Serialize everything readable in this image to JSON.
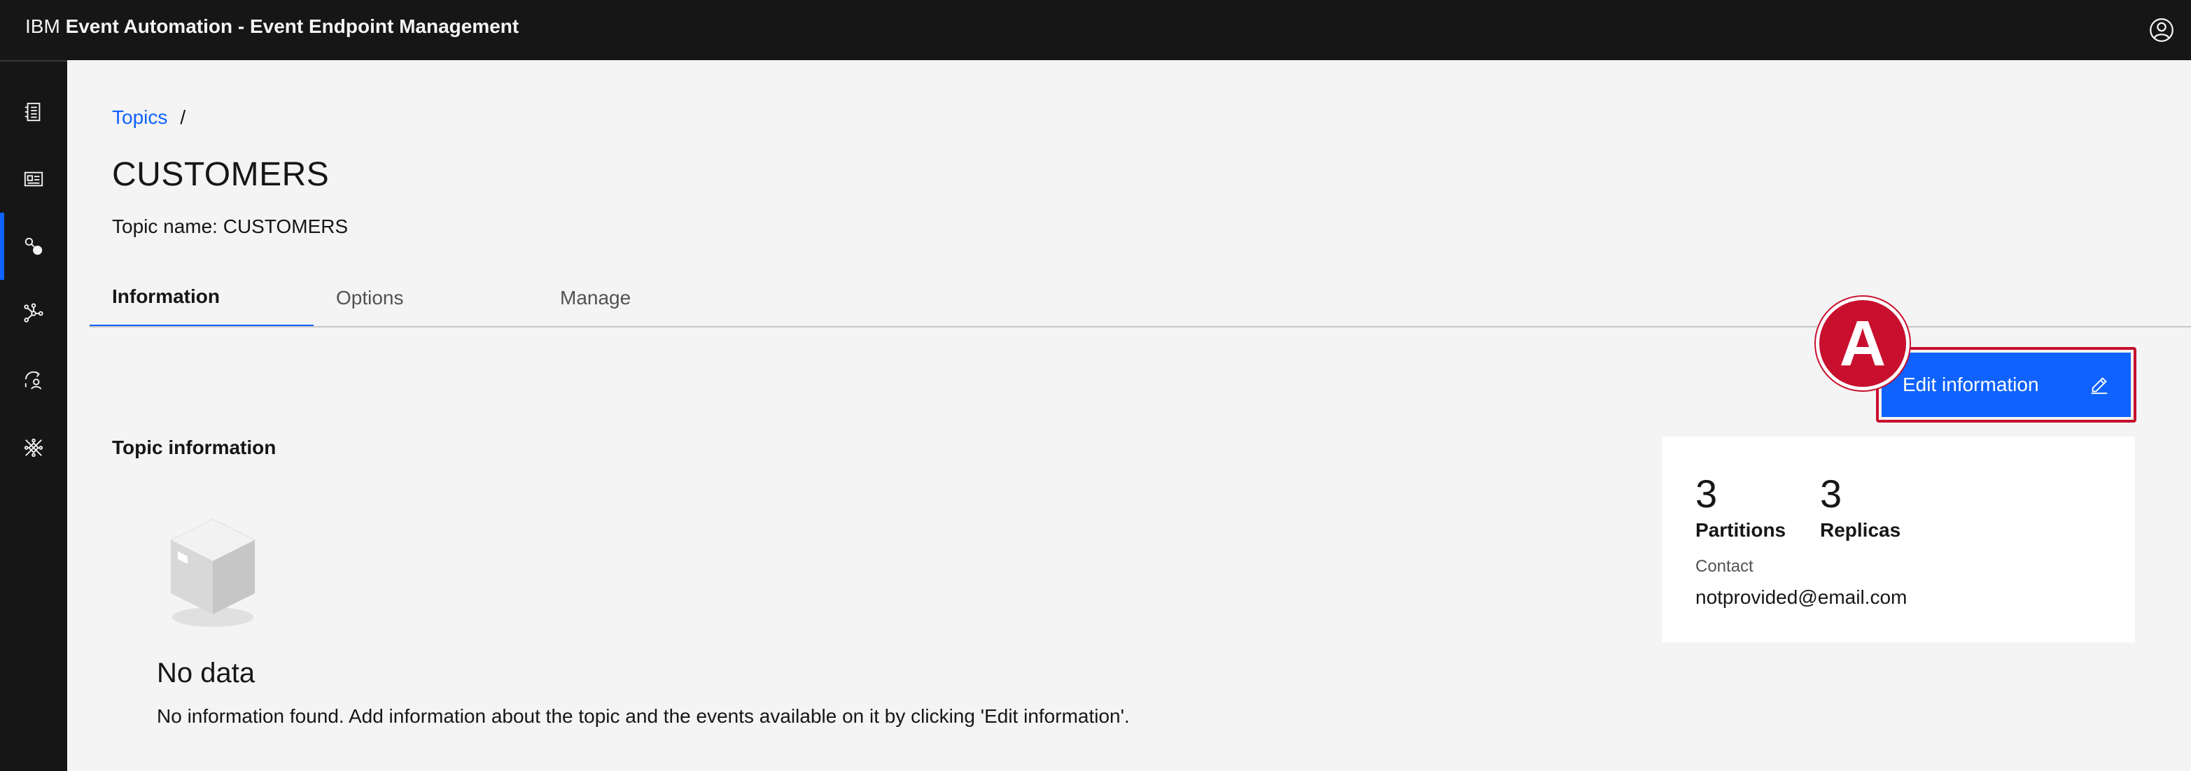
{
  "header": {
    "brand_prefix": "IBM",
    "brand_product": "Event Automation - Event Endpoint Management",
    "user_icon": "user-avatar-icon"
  },
  "sidenav": {
    "items": [
      {
        "icon": "catalog-icon",
        "active": false
      },
      {
        "icon": "subscriptions-card-icon",
        "active": false
      },
      {
        "icon": "topics-icon",
        "active": true
      },
      {
        "icon": "network-gateway-icon",
        "active": false
      },
      {
        "icon": "user-access-icon",
        "active": false
      },
      {
        "icon": "integrations-icon",
        "active": false
      }
    ]
  },
  "breadcrumb": {
    "link": "Topics",
    "separator": "/"
  },
  "page": {
    "title": "CUSTOMERS",
    "subtitle": "Topic name: CUSTOMERS"
  },
  "tabs": [
    {
      "label": "Information",
      "selected": true
    },
    {
      "label": "Options",
      "selected": false
    },
    {
      "label": "Manage",
      "selected": false
    }
  ],
  "edit_button": {
    "label": "Edit information",
    "icon": "edit-pencil-icon"
  },
  "annotation": {
    "marker": "A",
    "color": "#c8102e"
  },
  "topic_info": {
    "heading": "Topic information",
    "empty_icon": "empty-box-icon",
    "empty_title": "No data",
    "empty_description": "No information found. Add information about the topic and the events available on it by clicking 'Edit information'."
  },
  "info_card": {
    "partitions_value": "3",
    "partitions_label": "Partitions",
    "replicas_value": "3",
    "replicas_label": "Replicas",
    "contact_label": "Contact",
    "contact_value": "notprovided@email.com"
  },
  "colors": {
    "accent": "#0f62fe",
    "header_bg": "#161616",
    "page_bg": "#f4f4f4"
  }
}
